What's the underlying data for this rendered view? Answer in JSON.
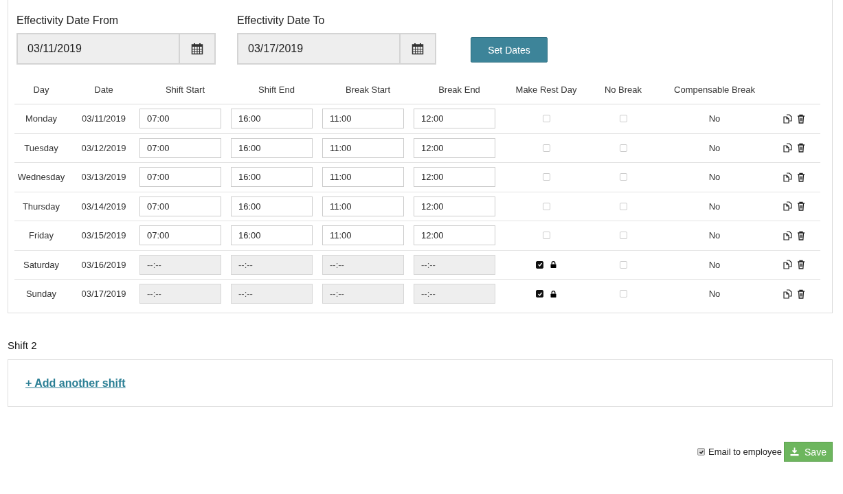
{
  "date_range": {
    "from": {
      "label": "Effectivity Date From",
      "value": "03/11/2019"
    },
    "to": {
      "label": "Effectivity Date To",
      "value": "03/17/2019"
    },
    "set_button": "Set Dates"
  },
  "table": {
    "columns": [
      "Day",
      "Date",
      "Shift Start",
      "Shift End",
      "Break Start",
      "Break End",
      "Make Rest Day",
      "No Break",
      "Compensable Break"
    ],
    "rows": [
      {
        "day": "Monday",
        "date": "03/11/2019",
        "times": [
          "07:00",
          "16:00",
          "11:00",
          "12:00"
        ],
        "rest_day": false,
        "locked": false,
        "no_break": false,
        "compensable": "No"
      },
      {
        "day": "Tuesday",
        "date": "03/12/2019",
        "times": [
          "07:00",
          "16:00",
          "11:00",
          "12:00"
        ],
        "rest_day": false,
        "locked": false,
        "no_break": false,
        "compensable": "No"
      },
      {
        "day": "Wednesday",
        "date": "03/13/2019",
        "times": [
          "07:00",
          "16:00",
          "11:00",
          "12:00"
        ],
        "rest_day": false,
        "locked": false,
        "no_break": false,
        "compensable": "No"
      },
      {
        "day": "Thursday",
        "date": "03/14/2019",
        "times": [
          "07:00",
          "16:00",
          "11:00",
          "12:00"
        ],
        "rest_day": false,
        "locked": false,
        "no_break": false,
        "compensable": "No"
      },
      {
        "day": "Friday",
        "date": "03/15/2019",
        "times": [
          "07:00",
          "16:00",
          "11:00",
          "12:00"
        ],
        "rest_day": false,
        "locked": false,
        "no_break": false,
        "compensable": "No"
      },
      {
        "day": "Saturday",
        "date": "03/16/2019",
        "time_placeholder": "--:--",
        "rest_day": true,
        "locked": true,
        "no_break": false,
        "compensable": "No"
      },
      {
        "day": "Sunday",
        "date": "03/17/2019",
        "time_placeholder": "--:--",
        "rest_day": true,
        "locked": true,
        "no_break": false,
        "compensable": "No"
      }
    ]
  },
  "shift2": {
    "title": "Shift 2",
    "add_link": "+ Add another shift"
  },
  "footer": {
    "email": {
      "label": "Email to employee",
      "checked": true
    },
    "save_button": "Save"
  }
}
